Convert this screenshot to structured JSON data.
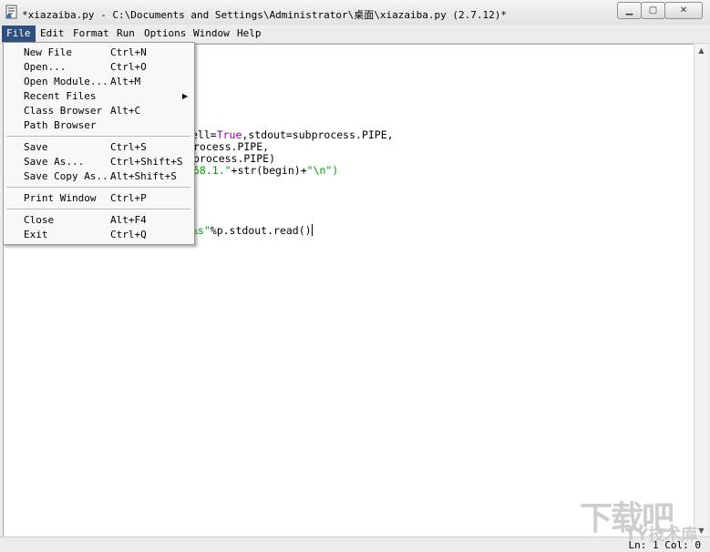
{
  "window": {
    "title": "*xiazaiba.py - C:\\Documents and Settings\\Administrator\\桌面\\xiazaiba.py (2.7.12)*",
    "buttons": {
      "minimize": "▁",
      "maximize": "▢",
      "close": "✕"
    }
  },
  "menubar": {
    "items": [
      {
        "label": "File"
      },
      {
        "label": "Edit"
      },
      {
        "label": "Format"
      },
      {
        "label": "Run"
      },
      {
        "label": "Options"
      },
      {
        "label": "Window"
      },
      {
        "label": "Help"
      }
    ],
    "active": "File"
  },
  "file_menu": {
    "items": [
      {
        "label": "New File",
        "shortcut": "Ctrl+N"
      },
      {
        "label": "Open...",
        "shortcut": "Ctrl+O"
      },
      {
        "label": "Open Module...",
        "shortcut": "Alt+M"
      },
      {
        "label": "Recent Files",
        "shortcut": ""
      },
      {
        "label": "Class Browser",
        "shortcut": "Alt+C"
      },
      {
        "label": "Path Browser",
        "shortcut": ""
      },
      {
        "label": "Save",
        "shortcut": "Ctrl+S"
      },
      {
        "label": "Save As...",
        "shortcut": "Ctrl+Shift+S"
      },
      {
        "label": "Save Copy As...",
        "shortcut": "Alt+Shift+S"
      },
      {
        "label": "Print Window",
        "shortcut": "Ctrl+P"
      },
      {
        "label": "Close",
        "shortcut": "Alt+F4"
      },
      {
        "label": "Exit",
        "shortcut": "Ctrl+Q"
      }
    ]
  },
  "editor": {
    "line1": {
      "pre": "ell=",
      "kw": "True",
      "post": ",stdout=subprocess.PIPE,"
    },
    "line2": {
      "text": "rocess.PIPE,"
    },
    "line3": {
      "text": "process.PIPE)"
    },
    "line4": {
      "str1": "68.1.\"",
      "mid": "+str(begin)+",
      "str2": "\"\\n\")"
    },
    "line5": {
      "str1": "%s\"",
      "post": "%p.stdout.read()"
    }
  },
  "statusbar": {
    "text": "Ln: 1  Col: 0"
  },
  "watermark": {
    "big": "下载吧",
    "small": "TY技术库"
  }
}
